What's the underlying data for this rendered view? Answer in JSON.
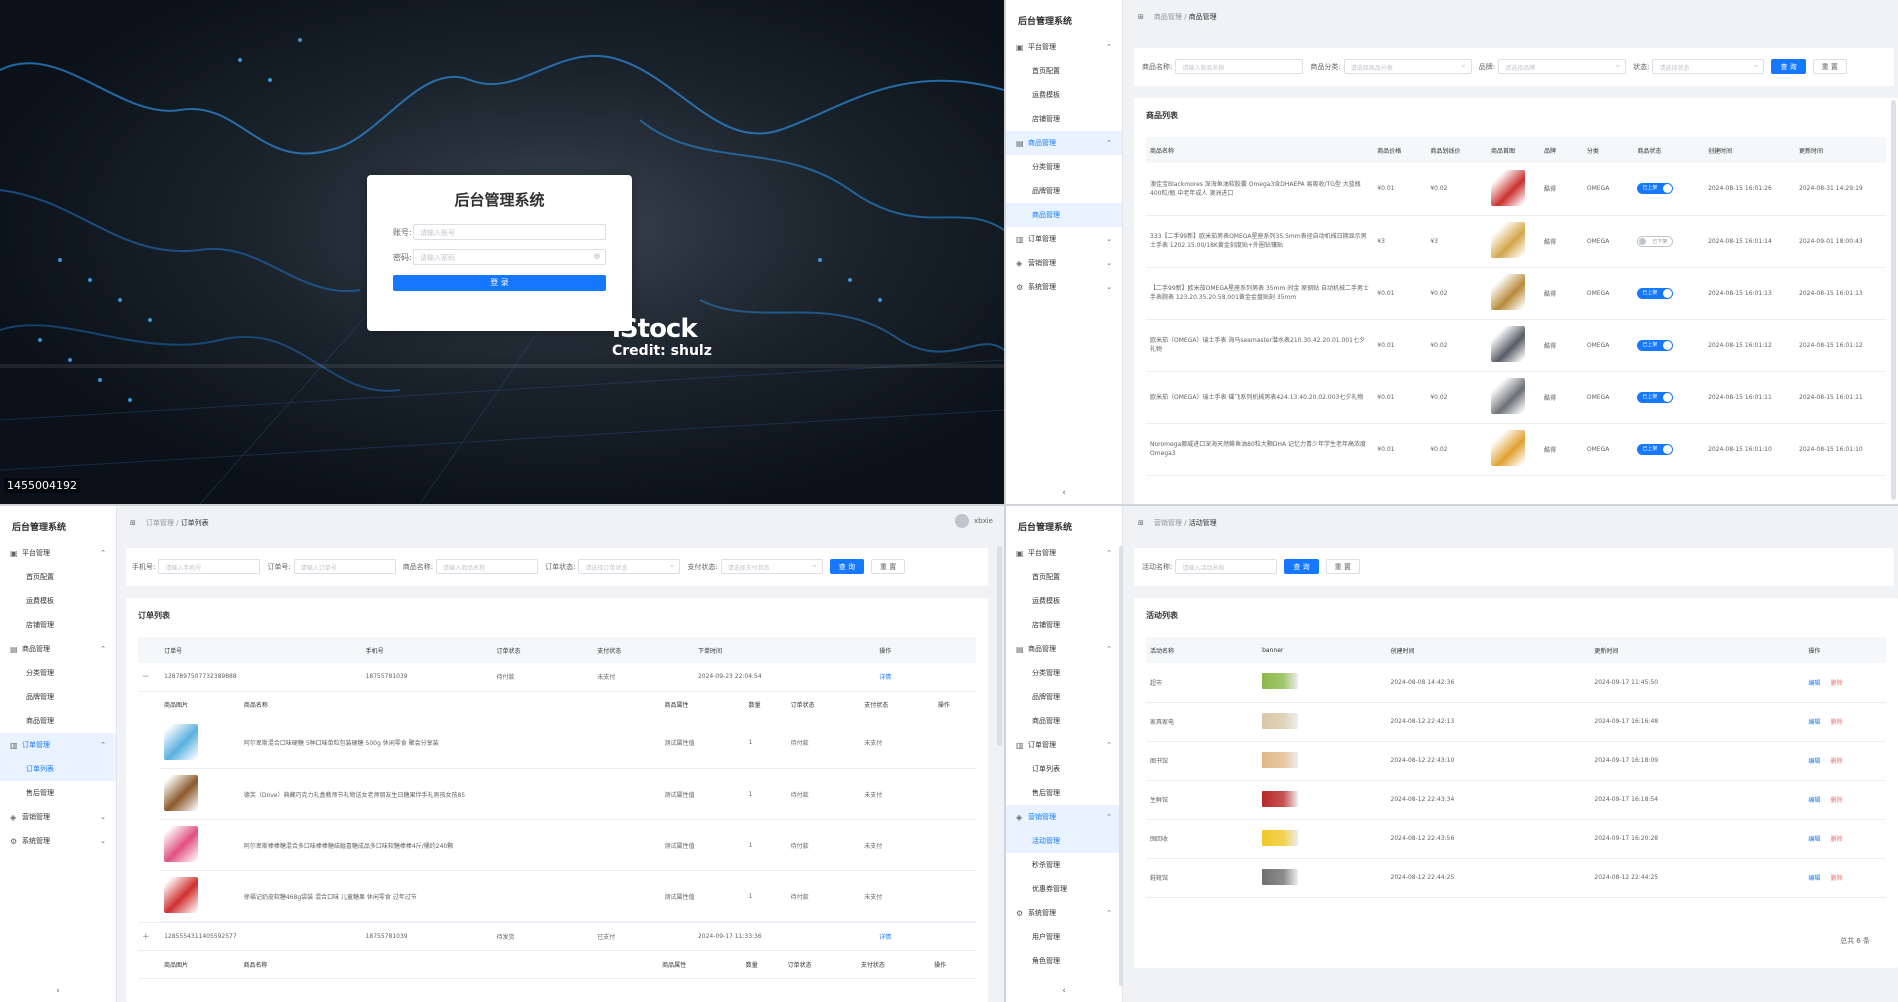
{
  "login": {
    "title": "后台管理系统",
    "account_label": "账号:",
    "account_placeholder": "请输入账号",
    "password_label": "密码:",
    "password_placeholder": "请输入密码",
    "submit": "登 录",
    "watermark_brand": "iStock",
    "watermark_credit": "Credit: shulz",
    "photo_id": "1455004192"
  },
  "app": {
    "brand": "后台管理系统",
    "collapse_icon": "‹",
    "user": "xbxie"
  },
  "menu": {
    "platform": "平台管理",
    "home_config": "首页配置",
    "freight": "运费模板",
    "store": "店铺管理",
    "goods": "商品管理",
    "category": "分类管理",
    "brand": "品牌管理",
    "goods_mgmt": "商品管理",
    "order": "订单管理",
    "order_list": "订单列表",
    "after_sale": "售后管理",
    "marketing": "营销管理",
    "activity": "活动管理",
    "seckill": "秒杀管理",
    "coupon": "优惠券管理",
    "system": "系统管理",
    "user": "用户管理",
    "role": "角色管理"
  },
  "goods_page": {
    "crumb_home": "⊞",
    "crumb1": "商品管理",
    "crumb2": "商品管理",
    "filters": {
      "name_label": "商品名称:",
      "name_ph": "请输入商品名称",
      "cat_label": "商品分类:",
      "cat_ph": "请选择商品分类",
      "brand_label": "品牌:",
      "brand_ph": "请选择品牌",
      "status_label": "状态:",
      "status_ph": "请选择状态",
      "search": "查 询",
      "reset": "重 置"
    },
    "list_title": "商品列表",
    "columns": [
      "商品名称",
      "商品价格",
      "商品划线价",
      "商品首图",
      "品牌",
      "分类",
      "商品状态",
      "创建时间",
      "更新时间"
    ],
    "rows": [
      {
        "name": "澳佳宝Blackmores 深海鱼油软胶囊 Omega3含DHAEPA 易吸收/TG型 大蓝瓶400粒/瓶 中老年成人 澳洲进口",
        "price": "¥0.01",
        "orig": "¥0.02",
        "brand": "酷得",
        "cat": "OMEGA",
        "status": "已上架",
        "on": true,
        "created": "2024-08-15 16:01:26",
        "updated": "2024-08-31 14:29:19",
        "color": "#c9302c"
      },
      {
        "name": "333【二手99新】欧米茄男表OMEGA星座系列35.5mm表径自动机械日期显示男士手表 1202.15.00/18K黄金刻度贴+外圈钻镶贴",
        "price": "¥3",
        "orig": "¥3",
        "brand": "酷得",
        "cat": "OMEGA",
        "status": "已下架",
        "on": false,
        "created": "2024-08-15 16:01:14",
        "updated": "2024-09-01 18:00:43",
        "color": "#d4a64a"
      },
      {
        "name": "【二手99新】欧米茄OMEGA星座系列男表 35mm 间金 原钢贴 自动机械二手男士手表腕表 123.20.35.20.58.001黄金金盘贴刻 35mm",
        "price": "¥0.01",
        "orig": "¥0.02",
        "brand": "酷得",
        "cat": "OMEGA",
        "status": "已上架",
        "on": true,
        "created": "2024-08-15 16:01:13",
        "updated": "2024-08-15 16:01:13",
        "color": "#b88a3a"
      },
      {
        "name": "欧米茄（OMEGA）瑞士手表 海马seamaster潜水表210.30.42.20.01.001七夕礼物",
        "price": "¥0.01",
        "orig": "¥0.02",
        "brand": "酷得",
        "cat": "OMEGA",
        "status": "已上架",
        "on": true,
        "created": "2024-08-15 16:01:12",
        "updated": "2024-08-15 16:01:12",
        "color": "#555c66"
      },
      {
        "name": "欧米茄（OMEGA）瑞士手表 碟飞系列机械男表424.13.40.20.02.003七夕礼物",
        "price": "¥0.01",
        "orig": "¥0.02",
        "brand": "酷得",
        "cat": "OMEGA",
        "status": "已上架",
        "on": true,
        "created": "2024-08-15 16:01:11",
        "updated": "2024-08-15 16:01:11",
        "color": "#6b6f76"
      },
      {
        "name": "Noromega挪威进口深海天然鲱鱼油80粒大颗DHA 记忆力青少年学生老年高浓度Omega3",
        "price": "¥0.01",
        "orig": "¥0.02",
        "brand": "酷得",
        "cat": "OMEGA",
        "status": "已上架",
        "on": true,
        "created": "2024-08-15 16:01:10",
        "updated": "2024-08-15 16:01:10",
        "color": "#e0a030"
      }
    ]
  },
  "order_page": {
    "crumb_home": "⊞",
    "crumb1": "订单管理",
    "crumb2": "订单列表",
    "filters": {
      "phone_label": "手机号:",
      "phone_ph": "请输入手机号",
      "order_label": "订单号:",
      "order_ph": "请输入订单号",
      "goods_label": "商品名称:",
      "goods_ph": "请输入商品名称",
      "ostatus_label": "订单状态:",
      "ostatus_ph": "请选择订单状态",
      "pstatus_label": "支付状态:",
      "pstatus_ph": "请选择支付状态",
      "search": "查 询",
      "reset": "重 置"
    },
    "list_title": "订单列表",
    "columns": [
      "订单号",
      "手机号",
      "订单状态",
      "支付状态",
      "下单时间",
      "操作"
    ],
    "sub_columns": [
      "商品图片",
      "商品名称",
      "商品属性",
      "数量",
      "订单状态",
      "支付状态",
      "操作"
    ],
    "orders": [
      {
        "expand": "−",
        "no": "1287897507732389888",
        "phone": "18755781039",
        "ostatus": "待付款",
        "pstatus": "未支付",
        "time": "2024-09-23 22:04:54",
        "action": "详情",
        "items": [
          {
            "name": "阿尔卑斯混合口味硬糖 5种口味单粒包装硬糖 500g 休闲零食 聚会分享装",
            "attr": "测试属性值",
            "qty": "1",
            "ostatus": "待付款",
            "pstatus": "未支付",
            "color": "#5ab0e0"
          },
          {
            "name": "德芙（Dove）典藏巧克力礼盒教师节礼物送女老师朋友生日糖果伴手礼男孩女孩85",
            "attr": "测试属性值",
            "qty": "1",
            "ostatus": "待付款",
            "pstatus": "未支付",
            "color": "#8a5a2a"
          },
          {
            "name": "阿尔卑斯棒棒糖混合多口味棒棒糖结婚喜糖成品多口味软糖棒棒4斤/桶约240颗",
            "attr": "测试属性值",
            "qty": "1",
            "ostatus": "待付款",
            "pstatus": "未支付",
            "color": "#e05080"
          },
          {
            "name": "徐福记奶皮软糖468g袋装 混合口味 儿童糖果 休闲零食 过年过节",
            "attr": "测试属性值",
            "qty": "1",
            "ostatus": "待付款",
            "pstatus": "未支付",
            "color": "#d03030"
          }
        ]
      },
      {
        "expand": "+",
        "no": "1285554311405592577",
        "phone": "18755781039",
        "ostatus": "待发货",
        "pstatus": "已支付",
        "time": "2024-09-17 11:33:36",
        "action": "详情"
      }
    ]
  },
  "activity_page": {
    "crumb_home": "⊞",
    "crumb1": "营销管理",
    "crumb2": "活动管理",
    "filters": {
      "name_label": "活动名称:",
      "name_ph": "请输入活动名称",
      "search": "查 询",
      "reset": "重 置"
    },
    "list_title": "活动列表",
    "columns": [
      "活动名称",
      "banner",
      "创建时间",
      "更新时间",
      "操作"
    ],
    "rows": [
      {
        "name": "超市",
        "created": "2024-08-08 14:42:36",
        "updated": "2024-09-17 11:45:50",
        "color": "#8ab84a"
      },
      {
        "name": "家具家电",
        "created": "2024-08-12 22:42:13",
        "updated": "2024-09-17 16:16:48",
        "color": "#d8c8a8"
      },
      {
        "name": "图书馆",
        "created": "2024-08-12 22:43:10",
        "updated": "2024-09-17 16:18:09",
        "color": "#e0b888"
      },
      {
        "name": "生鲜馆",
        "created": "2024-08-12 22:43:34",
        "updated": "2024-09-17 16:18:54",
        "color": "#b82828"
      },
      {
        "name": "囤回收",
        "created": "2024-08-12 22:43:56",
        "updated": "2024-09-17 16:20:28",
        "color": "#f0c828"
      },
      {
        "name": "鞋靴馆",
        "created": "2024-08-12 22:44:25",
        "updated": "2024-08-12 22:44:25",
        "color": "#707070"
      }
    ],
    "edit": "编辑",
    "delete": "删除",
    "total": "总共 6 条"
  }
}
